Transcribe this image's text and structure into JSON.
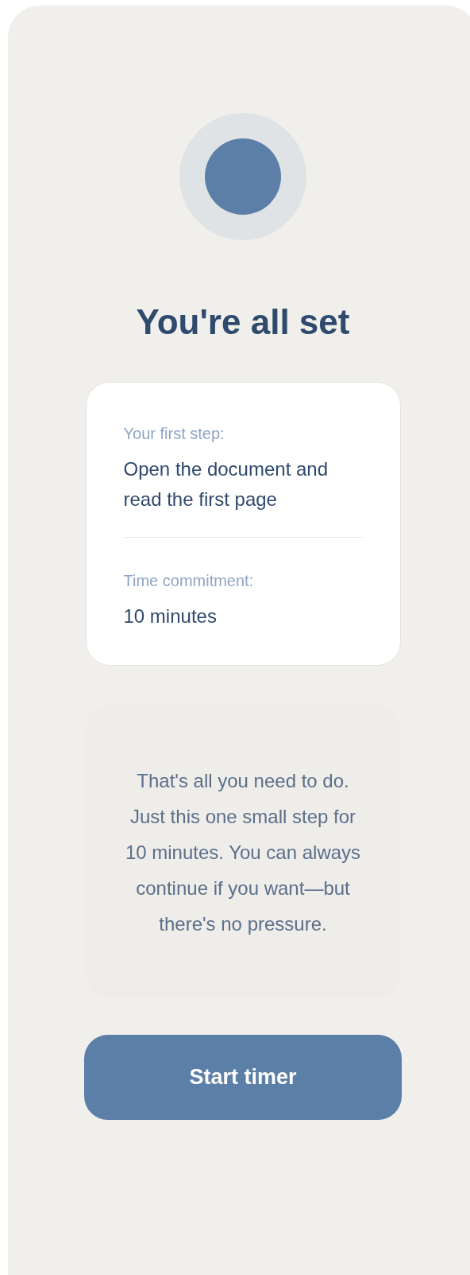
{
  "title": "You're all set",
  "details": [
    {
      "label": "Your first step:",
      "value": "Open the document and read the first page"
    },
    {
      "label": "Time commitment:",
      "value": "10 minutes"
    }
  ],
  "message": "That's all you need to do. Just this one small step for 10 minutes. You can always continue if you want—but there's no pressure.",
  "button": "Start timer"
}
